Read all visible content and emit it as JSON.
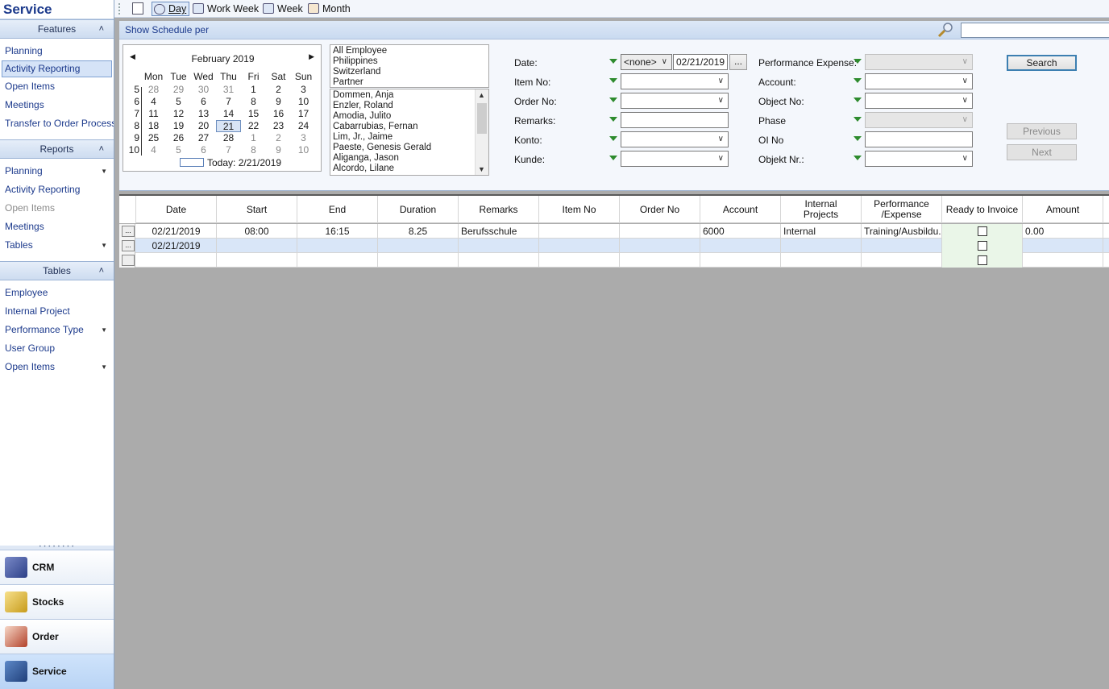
{
  "sidebar": {
    "title": "Service",
    "features": {
      "header": "Features",
      "items": [
        "Planning",
        "Activity Reporting",
        "Open Items",
        "Meetings",
        "Transfer to Order Processing"
      ]
    },
    "reports": {
      "header": "Reports",
      "items": [
        "Planning",
        "Activity Reporting",
        "Open Items",
        "Meetings",
        "Tables"
      ]
    },
    "tables": {
      "header": "Tables",
      "items": [
        "Employee",
        "Internal Project",
        "Performance Type",
        "User Group",
        "Open Items"
      ]
    },
    "modules": [
      "CRM",
      "Stocks",
      "Order",
      "Service"
    ]
  },
  "toolbar": {
    "day": "Day",
    "work_week": "Work Week",
    "week": "Week",
    "month": "Month"
  },
  "filter": {
    "header": "Show Schedule per",
    "calendar": {
      "month": "February 2019",
      "weekdays": [
        "Mon",
        "Tue",
        "Wed",
        "Thu",
        "Fri",
        "Sat",
        "Sun"
      ],
      "weeks": [
        {
          "wk": "5",
          "days": [
            "28",
            "29",
            "30",
            "31",
            "1",
            "2",
            "3"
          ]
        },
        {
          "wk": "6",
          "days": [
            "4",
            "5",
            "6",
            "7",
            "8",
            "9",
            "10"
          ]
        },
        {
          "wk": "7",
          "days": [
            "11",
            "12",
            "13",
            "14",
            "15",
            "16",
            "17"
          ]
        },
        {
          "wk": "8",
          "days": [
            "18",
            "19",
            "20",
            "21",
            "22",
            "23",
            "24"
          ]
        },
        {
          "wk": "9",
          "days": [
            "25",
            "26",
            "27",
            "28",
            "1",
            "2",
            "3"
          ]
        },
        {
          "wk": "10",
          "days": [
            "4",
            "5",
            "6",
            "7",
            "8",
            "9",
            "10"
          ]
        }
      ],
      "today_label": "Today: 2/21/2019"
    },
    "groups": [
      "All Employee",
      "Philippines",
      "Switzerland",
      "Partner"
    ],
    "employees": [
      "Dommen, Anja",
      "Enzler, Roland",
      "Amodia, Julito",
      "Cabarrubias, Fernan",
      "Lim, Jr., Jaime",
      "Paeste, Genesis Gerald",
      "Aliganga, Jason",
      "Alcordo, Lilane"
    ],
    "labels": {
      "date": "Date:",
      "item_no": "Item No:",
      "order_no": "Order No:",
      "remarks": "Remarks:",
      "konto": "Konto:",
      "kunde": "Kunde:",
      "perf_expense": "Performance Expense:",
      "account": "Account:",
      "object_no": "Object No:",
      "phase": "Phase",
      "oi_no": "OI No",
      "objekt_nr": "Objekt Nr.:"
    },
    "date_mode": "<none>",
    "date_value": "02/21/2019",
    "ellipsis": "...",
    "buttons": {
      "search": "Search",
      "previous": "Previous",
      "next": "Next"
    }
  },
  "grid": {
    "columns": [
      "Date",
      "Start",
      "End",
      "Duration",
      "Remarks",
      "Item No",
      "Order No",
      "Account",
      "Internal Projects",
      "Performance /Expense",
      "Ready to Invoice",
      "Amount"
    ],
    "rows": [
      {
        "date": "02/21/2019",
        "start": "08:00",
        "end": "16:15",
        "duration": "8.25",
        "remarks": "Berufsschule",
        "item_no": "",
        "order_no": "",
        "account": "6000",
        "internal": "Internal",
        "perf": "Training/Ausbildu...",
        "amount": "0.00"
      },
      {
        "date": "02/21/2019",
        "start": "",
        "end": "",
        "duration": "",
        "remarks": "",
        "item_no": "",
        "order_no": "",
        "account": "",
        "internal": "",
        "perf": "",
        "amount": ""
      }
    ],
    "row_button": "..."
  }
}
